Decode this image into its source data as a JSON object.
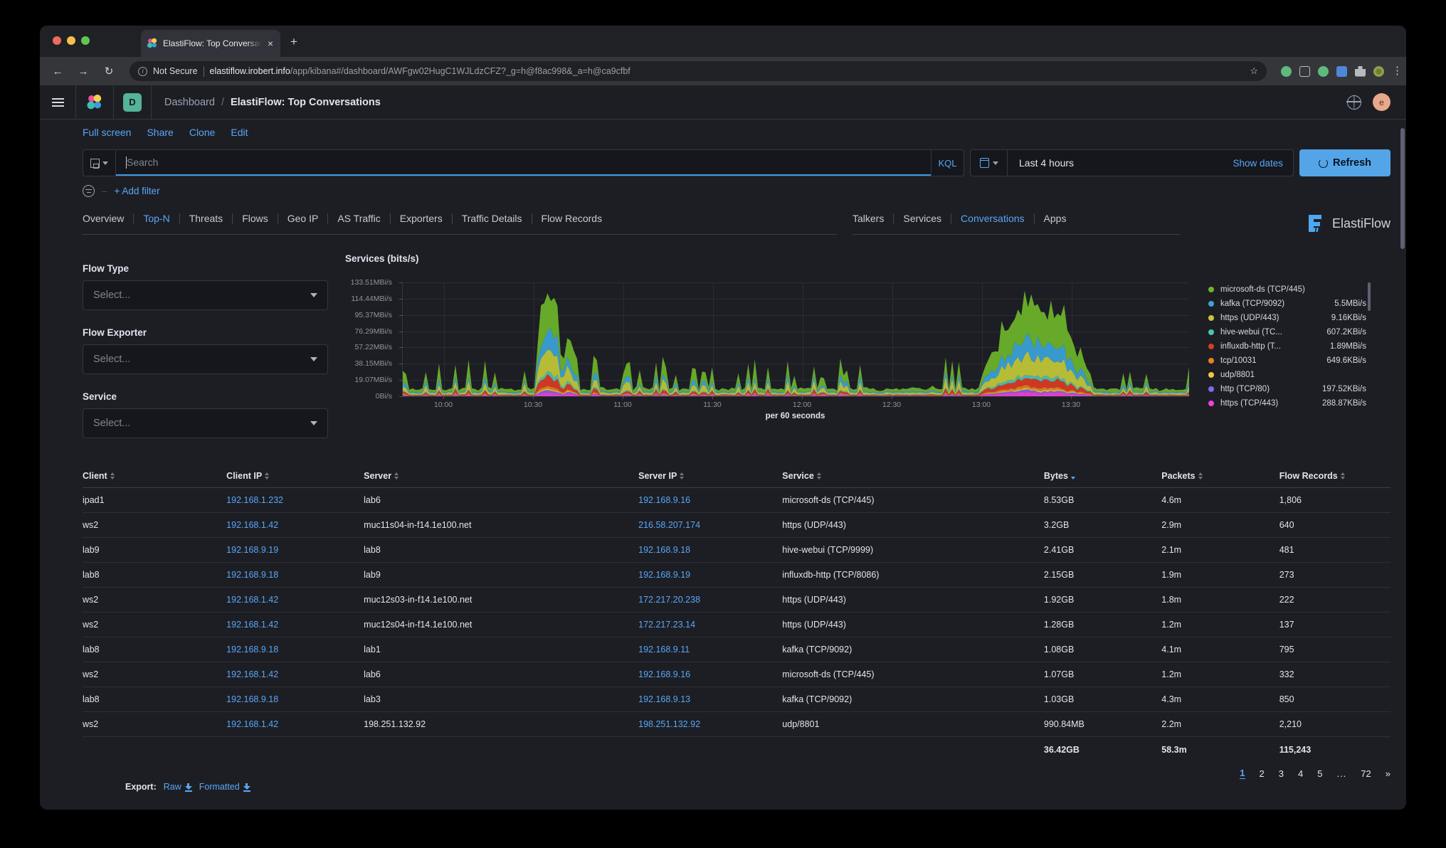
{
  "browser": {
    "tab": {
      "title": "ElastiFlow: Top Conversations",
      "favicon": "elastic-icon",
      "close_label": "×"
    },
    "new_tab_label": "+",
    "nav": {
      "back": "←",
      "forward": "→",
      "reload": "↻"
    },
    "omnibox": {
      "security_label": "Not Secure",
      "url_host": "elastiflow.irobert.info",
      "url_path": "/app/kibana#/dashboard/AWFgw02HugC1WJLdzCFZ?_g=h@f8ac998&_a=h@ca9cfbf",
      "star": "☆"
    }
  },
  "kibana": {
    "space_badge": "D",
    "breadcrumb": {
      "root": "Dashboard",
      "separator": "/",
      "current": "ElastiFlow: Top Conversations"
    },
    "avatar_initial": "e",
    "actions": [
      "Full screen",
      "Share",
      "Clone",
      "Edit"
    ],
    "search": {
      "placeholder": "Search",
      "language": "KQL"
    },
    "timepicker": {
      "value": "Last 4 hours",
      "show_dates": "Show dates"
    },
    "refresh_label": "Refresh",
    "filters": {
      "add_label": "+ Add filter"
    }
  },
  "dashnav": {
    "primary": [
      {
        "label": "Overview",
        "active": false
      },
      {
        "label": "Top-N",
        "active": true
      },
      {
        "label": "Threats",
        "active": false
      },
      {
        "label": "Flows",
        "active": false
      },
      {
        "label": "Geo IP",
        "active": false
      },
      {
        "label": "AS Traffic",
        "active": false
      },
      {
        "label": "Exporters",
        "active": false
      },
      {
        "label": "Traffic Details",
        "active": false
      },
      {
        "label": "Flow Records",
        "active": false
      }
    ],
    "secondary": [
      {
        "label": "Talkers",
        "active": false
      },
      {
        "label": "Services",
        "active": false
      },
      {
        "label": "Conversations",
        "active": true
      },
      {
        "label": "Apps",
        "active": false
      }
    ],
    "brand": "ElastiFlow"
  },
  "filters_panel": [
    {
      "label": "Flow Type",
      "placeholder": "Select..."
    },
    {
      "label": "Flow Exporter",
      "placeholder": "Select..."
    },
    {
      "label": "Service",
      "placeholder": "Select..."
    }
  ],
  "chart_data": {
    "type": "area",
    "title": "Services (bits/s)",
    "xlabel": "per 60 seconds",
    "ylabel": "",
    "ytick_labels": [
      "133.51MBi/s",
      "114.44MBi/s",
      "95.37MBi/s",
      "76.29MBi/s",
      "57.22MBi/s",
      "38.15MBi/s",
      "19.07MBi/s",
      "0Bi/s"
    ],
    "ytick_values": [
      133.51,
      114.44,
      95.37,
      76.29,
      57.22,
      38.15,
      19.07,
      0
    ],
    "ylim": [
      0,
      133.51
    ],
    "xtick_labels": [
      "10:00",
      "10:30",
      "11:00",
      "11:30",
      "12:00",
      "12:30",
      "13:00",
      "13:30"
    ],
    "grid": true,
    "legend_position": "right",
    "stacked": true,
    "series": [
      {
        "name": "microsoft-ds (TCP/445)",
        "value": "",
        "color": "#6eb52a"
      },
      {
        "name": "kafka (TCP/9092)",
        "value": "5.5MBi/s",
        "color": "#3ba5db"
      },
      {
        "name": "https (UDP/443)",
        "value": "9.16KBi/s",
        "color": "#c3ca38"
      },
      {
        "name": "hive-webui (TC...",
        "value": "607.2KBi/s",
        "color": "#4cc4b5"
      },
      {
        "name": "influxdb-http (T...",
        "value": "1.89MBi/s",
        "color": "#dc3b25"
      },
      {
        "name": "tcp/10031",
        "value": "649.6KBi/s",
        "color": "#e8811e"
      },
      {
        "name": "udp/8801",
        "value": "",
        "color": "#f3c73c"
      },
      {
        "name": "http (TCP/80)",
        "value": "197.52KBi/s",
        "color": "#8068ee"
      },
      {
        "name": "https (TCP/443)",
        "value": "288.87KBi/s",
        "color": "#ec44d8"
      }
    ]
  },
  "table": {
    "columns": [
      "Client",
      "Client IP",
      "Server",
      "Server IP",
      "Service",
      "Bytes",
      "Packets",
      "Flow Records"
    ],
    "sorted_column": "Bytes",
    "rows": [
      {
        "client": "ipad1",
        "client_ip": "192.168.1.232",
        "server": "lab6",
        "server_ip": "192.168.9.16",
        "service": "microsoft-ds (TCP/445)",
        "bytes": "8.53GB",
        "packets": "4.6m",
        "flow_records": "1,806"
      },
      {
        "client": "ws2",
        "client_ip": "192.168.1.42",
        "server": "muc11s04-in-f14.1e100.net",
        "server_ip": "216.58.207.174",
        "service": "https (UDP/443)",
        "bytes": "3.2GB",
        "packets": "2.9m",
        "flow_records": "640"
      },
      {
        "client": "lab9",
        "client_ip": "192.168.9.19",
        "server": "lab8",
        "server_ip": "192.168.9.18",
        "service": "hive-webui (TCP/9999)",
        "bytes": "2.41GB",
        "packets": "2.1m",
        "flow_records": "481"
      },
      {
        "client": "lab8",
        "client_ip": "192.168.9.18",
        "server": "lab9",
        "server_ip": "192.168.9.19",
        "service": "influxdb-http (TCP/8086)",
        "bytes": "2.15GB",
        "packets": "1.9m",
        "flow_records": "273"
      },
      {
        "client": "ws2",
        "client_ip": "192.168.1.42",
        "server": "muc12s03-in-f14.1e100.net",
        "server_ip": "172.217.20.238",
        "service": "https (UDP/443)",
        "bytes": "1.92GB",
        "packets": "1.8m",
        "flow_records": "222"
      },
      {
        "client": "ws2",
        "client_ip": "192.168.1.42",
        "server": "muc12s04-in-f14.1e100.net",
        "server_ip": "172.217.23.14",
        "service": "https (UDP/443)",
        "bytes": "1.28GB",
        "packets": "1.2m",
        "flow_records": "137"
      },
      {
        "client": "lab8",
        "client_ip": "192.168.9.18",
        "server": "lab1",
        "server_ip": "192.168.9.11",
        "service": "kafka (TCP/9092)",
        "bytes": "1.08GB",
        "packets": "4.1m",
        "flow_records": "795"
      },
      {
        "client": "ws2",
        "client_ip": "192.168.1.42",
        "server": "lab6",
        "server_ip": "192.168.9.16",
        "service": "microsoft-ds (TCP/445)",
        "bytes": "1.07GB",
        "packets": "1.2m",
        "flow_records": "332"
      },
      {
        "client": "lab8",
        "client_ip": "192.168.9.18",
        "server": "lab3",
        "server_ip": "192.168.9.13",
        "service": "kafka (TCP/9092)",
        "bytes": "1.03GB",
        "packets": "4.3m",
        "flow_records": "850"
      },
      {
        "client": "ws2",
        "client_ip": "192.168.1.42",
        "server": "198.251.132.92",
        "server_ip": "198.251.132.92",
        "service": "udp/8801",
        "bytes": "990.84MB",
        "packets": "2.2m",
        "flow_records": "2,210"
      }
    ],
    "totals": {
      "bytes": "36.42GB",
      "packets": "58.3m",
      "flow_records": "115,243"
    }
  },
  "export": {
    "label": "Export:",
    "raw": "Raw",
    "formatted": "Formatted"
  },
  "pagination": {
    "pages": [
      "1",
      "2",
      "3",
      "4",
      "5",
      "...",
      "72"
    ],
    "active": "1",
    "next": "»"
  }
}
